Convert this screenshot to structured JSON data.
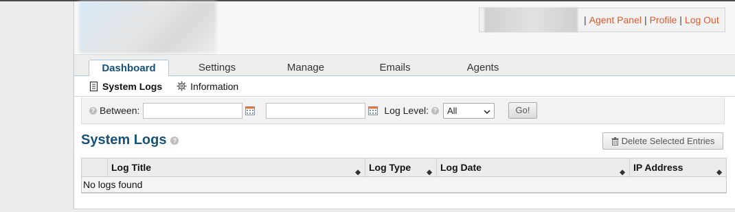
{
  "header": {
    "user_links": {
      "separator": "|",
      "agent_panel": "Agent Panel",
      "profile": "Profile",
      "logout": "Log Out"
    }
  },
  "tabs": [
    {
      "label": "Dashboard",
      "active": true
    },
    {
      "label": "Settings",
      "active": false
    },
    {
      "label": "Manage",
      "active": false
    },
    {
      "label": "Emails",
      "active": false
    },
    {
      "label": "Agents",
      "active": false
    }
  ],
  "subnav": [
    {
      "label": "System Logs",
      "icon": "document-icon",
      "active": true
    },
    {
      "label": "Information",
      "icon": "gear-icon",
      "active": false
    }
  ],
  "filter": {
    "between_label": "Between:",
    "start_value": "",
    "end_value": "",
    "log_level_label": "Log Level:",
    "log_level_value": "All",
    "go_label": "Go!"
  },
  "section": {
    "title": "System Logs",
    "delete_label": "Delete Selected Entries"
  },
  "table": {
    "columns": [
      "",
      "Log Title",
      "Log Type",
      "Log Date",
      "IP Address"
    ],
    "empty_message": "No logs found"
  },
  "colors": {
    "accent_link": "#e0582a",
    "heading_blue": "#15527b",
    "tab_border": "#a9c9e0"
  }
}
